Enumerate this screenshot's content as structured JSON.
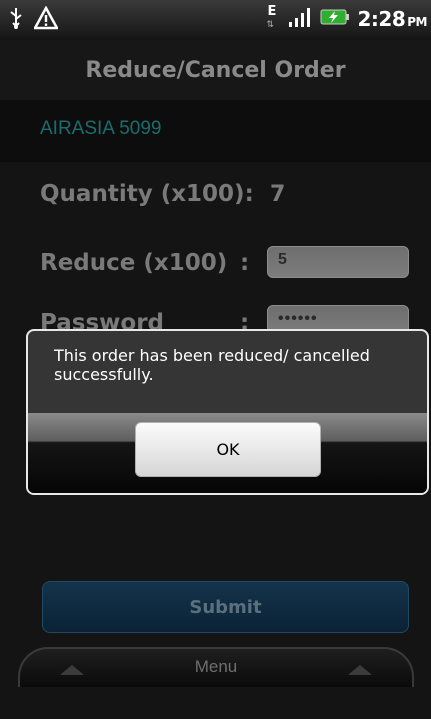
{
  "status_bar": {
    "usb_icon": "usb-icon",
    "alert_icon": "warning-triangle-icon",
    "network_type": "E",
    "signal_icon": "signal-bars-icon",
    "battery_icon": "battery-charging-icon",
    "time": "2:28",
    "ampm": "PM"
  },
  "screen": {
    "title": "Reduce/Cancel Order",
    "stock": "AIRASIA  5099",
    "quantity_label": "Quantity (x100):",
    "quantity_value": "7",
    "reduce_label": "Reduce (x100)",
    "reduce_colon": ":",
    "reduce_value": "5",
    "password_label": "Password",
    "password_colon": ":",
    "password_value": "••••••",
    "submit_label": "Submit",
    "menu_label": "Menu"
  },
  "dialog": {
    "message": "This order has been reduced/ cancelled successfully.",
    "ok_label": "OK"
  },
  "colors": {
    "stock_text": "#1a6d6d",
    "dialog_border": "#e8e8e8",
    "submit_bg": "#0b2236"
  }
}
